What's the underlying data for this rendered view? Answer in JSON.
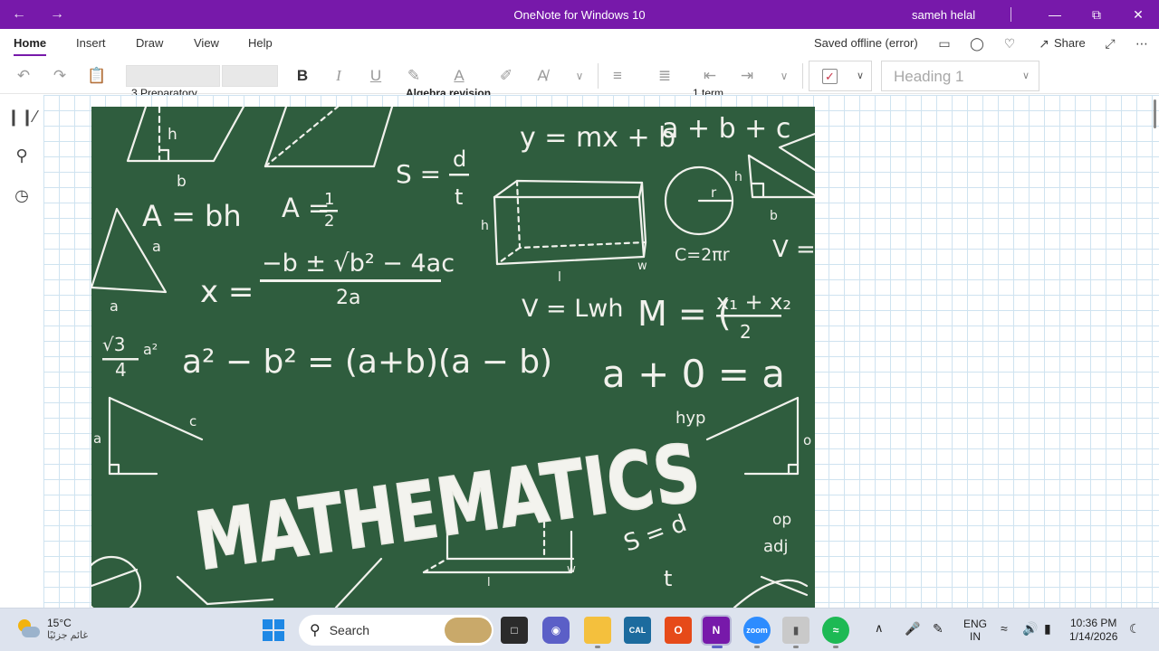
{
  "titlebar": {
    "title": "OneNote for Windows 10",
    "user": "sameh helal",
    "back_icon": "arrow-left-icon",
    "forward_icon": "arrow-right-icon",
    "accent": "#7719aa"
  },
  "tabs": [
    {
      "label": "Home"
    },
    {
      "label": "Insert"
    },
    {
      "label": "Draw"
    },
    {
      "label": "View"
    },
    {
      "label": "Help"
    }
  ],
  "status": "Saved offline (error)",
  "share_label": "Share",
  "toolbar": {
    "font_name": "",
    "font_size": "",
    "style": "Heading 1"
  },
  "page": {
    "cut_texts": [
      "3   Preparatory",
      "Algebra revision",
      "1   term"
    ]
  },
  "board": {
    "bg": "#2f5d3e",
    "formulas": {
      "line": "y = mx + b",
      "sum": "a + b + c",
      "speed": "S =",
      "speed_num": "d",
      "speed_den": "t",
      "area_para": "A = bh",
      "area_half": "A =",
      "half_num": "1",
      "half_den": "2",
      "quad_lhs": "x =",
      "quad_num": "−b ± √b² − 4ac",
      "quad_den": "2a",
      "circle": "C=2πr",
      "volume": "V = Lwh",
      "v_partial": "V =",
      "mid": "M = (",
      "mid_num": "x₁ + x₂",
      "mid_den": "2",
      "diff_sq": "a² − b² = (a+b)(a − b)",
      "sqrt3_num": "√3",
      "sqrt3_den": "4",
      "a_sq": "a²",
      "identity": "a + 0 = a",
      "hyp": "hyp",
      "op": "op",
      "adj": "adj",
      "title": "MATHEMATICS",
      "speed2": "S = d",
      "speed2_den": "t"
    },
    "labels": {
      "h": "h",
      "b": "b",
      "a": "a",
      "c": "c",
      "w": "w",
      "l": "l",
      "r": "r",
      "o": "o"
    }
  },
  "taskbar": {
    "weather_temp": "15°C",
    "weather_cond": "غائم جزئيًا",
    "search_placeholder": "Search",
    "lang1": "ENG",
    "lang2": "IN",
    "time": "10:36 PM",
    "date": "1/14/2026"
  }
}
